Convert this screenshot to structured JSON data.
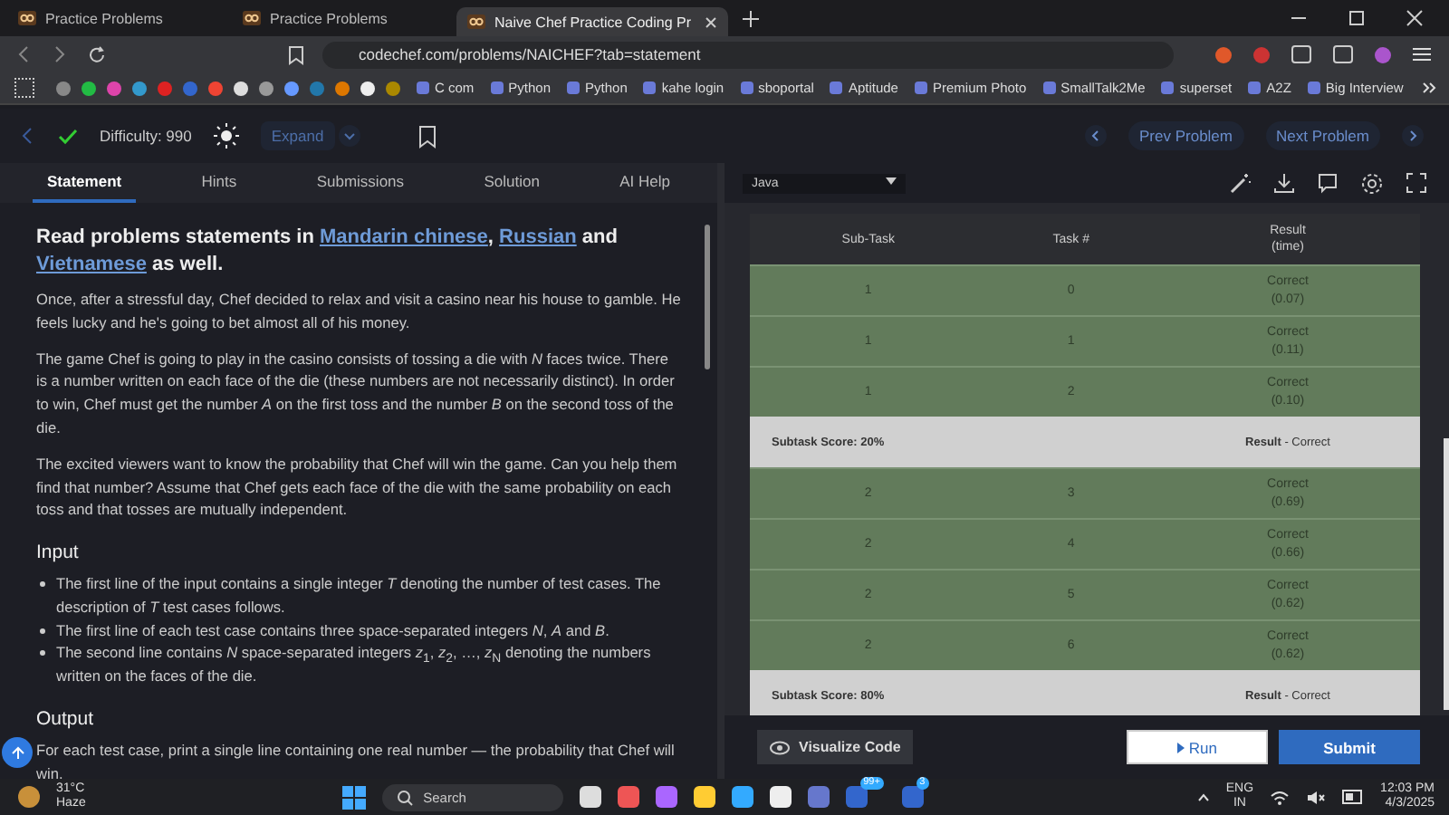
{
  "browser": {
    "tabs": [
      {
        "title": "Practice Problems",
        "selected": false
      },
      {
        "title": "Practice Problems",
        "selected": false
      },
      {
        "title": "Naive Chef Practice Coding Pr",
        "selected": true
      }
    ],
    "url": "codechef.com/problems/NAICHEF?tab=statement",
    "bookmarks": [
      "C com",
      "Python",
      "Python",
      "kahe login",
      "sboportal",
      "Aptitude",
      "Premium Photo",
      "SmallTalk2Me",
      "superset",
      "A2Z",
      "Big Interview"
    ]
  },
  "toolbar": {
    "difficulty": "Difficulty: 990",
    "expand": "Expand",
    "prev": "Prev Problem",
    "next": "Next Problem"
  },
  "tabs": [
    {
      "label": "Statement",
      "selected": true
    },
    {
      "label": "Hints",
      "selected": false
    },
    {
      "label": "Submissions",
      "selected": false
    },
    {
      "label": "Solution",
      "selected": false
    },
    {
      "label": "AI Help",
      "selected": false
    }
  ],
  "language": "Java",
  "statement": {
    "heading": [
      {
        "kind": "text",
        "text": "Read problems statements in "
      },
      {
        "kind": "link",
        "text": "Mandarin chinese"
      },
      {
        "kind": "text",
        "text": ", "
      },
      {
        "kind": "link",
        "text": "Russian"
      },
      {
        "kind": "text",
        "text": " and "
      },
      {
        "kind": "link",
        "text": "Vietnamese"
      },
      {
        "kind": "text",
        "text": " as well."
      }
    ],
    "paragraphs": [
      "Once, after a stressful day, Chef decided to relax and visit a casino near his house to gamble. He feels lucky and he's going to bet almost all of his money.",
      "The game Chef is going to play in the casino consists of tossing a die with *N* faces twice. There is a number written on each face of the die (these numbers are not necessarily distinct). In order to win, Chef must get the number *A* on the first toss and the number *B* on the second toss of the die.",
      "The excited viewers want to know the probability that Chef will win the game. Can you help them find that number? Assume that Chef gets each face of the die with the same probability on each toss and that tosses are mutually independent."
    ],
    "sections": [
      {
        "title": "Input",
        "bullets": [
          "The first line of the input contains a single integer *T* denoting the number of test cases. The description of *T* test cases follows.",
          "The first line of each test case contains three space-separated integers *N*, *A* and *B*.",
          "The second line contains *N* space-separated integers *z*$_{1}$, *z*$_{2}$, …, *z*$_{N}$ denoting the numbers written on the faces of the die."
        ]
      },
      {
        "title": "Output",
        "text": "For each test case, print a single line containing one real number — the probability that Chef will win."
      }
    ]
  },
  "results": {
    "columns": [
      [
        "Sub-Task"
      ],
      [
        "Task #"
      ],
      [
        "Result",
        "(time)"
      ]
    ],
    "rows": [
      {
        "kind": "test",
        "subtask": "1",
        "task": "0",
        "result": "Correct",
        "time": "(0.07)"
      },
      {
        "kind": "test",
        "subtask": "1",
        "task": "1",
        "result": "Correct",
        "time": "(0.11)"
      },
      {
        "kind": "test",
        "subtask": "1",
        "task": "2",
        "result": "Correct",
        "time": "(0.10)"
      },
      {
        "kind": "summary",
        "score": "Subtask Score: 20%",
        "label": "Result",
        "result": "- Correct"
      },
      {
        "kind": "test",
        "subtask": "2",
        "task": "3",
        "result": "Correct",
        "time": "(0.69)"
      },
      {
        "kind": "test",
        "subtask": "2",
        "task": "4",
        "result": "Correct",
        "time": "(0.66)"
      },
      {
        "kind": "test",
        "subtask": "2",
        "task": "5",
        "result": "Correct",
        "time": "(0.62)"
      },
      {
        "kind": "test",
        "subtask": "2",
        "task": "6",
        "result": "Correct",
        "time": "(0.62)"
      },
      {
        "kind": "summary",
        "score": "Subtask Score: 80%",
        "label": "Result",
        "result": "- Correct"
      }
    ]
  },
  "actions": {
    "visualize": "Visualize Code",
    "run": "Run",
    "submit": "Submit"
  },
  "taskbar": {
    "temperature": "31°C",
    "weather": "Haze",
    "search": "Search",
    "badges": [
      "99+",
      "3"
    ],
    "lang": [
      "ENG",
      "IN"
    ],
    "time": "12:03 PM",
    "date": "4/3/2025"
  }
}
